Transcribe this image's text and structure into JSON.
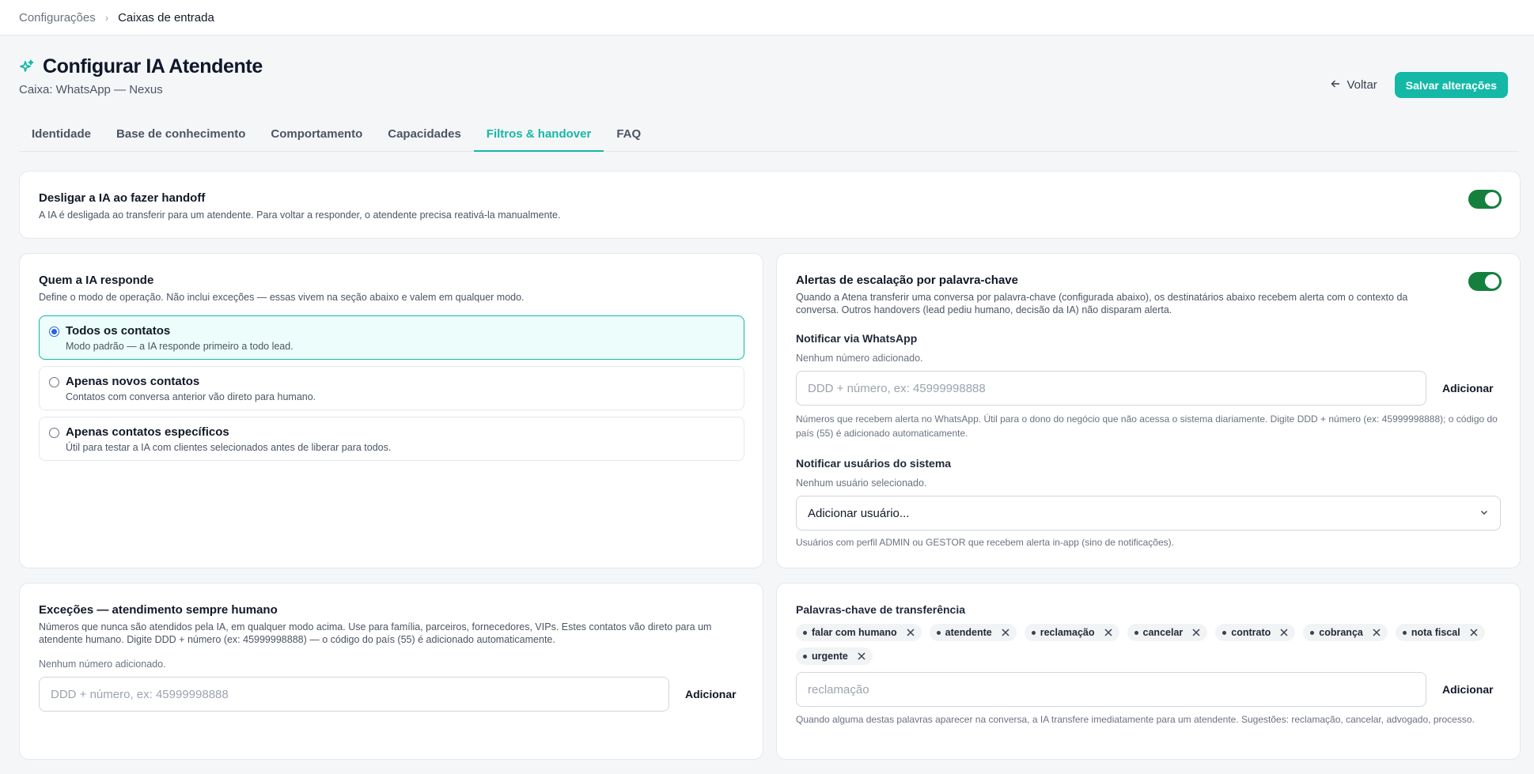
{
  "breadcrumb": {
    "root": "Configurações",
    "separator": "›",
    "current": "Caixas de entrada"
  },
  "header": {
    "title": "Configurar IA Atendente",
    "subtitle": "Caixa: WhatsApp — Nexus",
    "back_label": "Voltar",
    "save_label": "Salvar alterações"
  },
  "tabs": [
    {
      "label": "Identidade",
      "active": false
    },
    {
      "label": "Base de conhecimento",
      "active": false
    },
    {
      "label": "Comportamento",
      "active": false
    },
    {
      "label": "Capacidades",
      "active": false
    },
    {
      "label": "Filtros & handover",
      "active": true
    },
    {
      "label": "FAQ",
      "active": false
    }
  ],
  "handoff": {
    "title": "Desligar a IA ao fazer handoff",
    "desc": "A IA é desligada ao transferir para um atendente. Para voltar a responder, o atendente precisa reativá-la manualmente.",
    "enabled": true
  },
  "responds": {
    "title": "Quem a IA responde",
    "desc": "Define o modo de operação. Não inclui exceções — essas vivem na seção abaixo e valem em qualquer modo.",
    "options": [
      {
        "title": "Todos os contatos",
        "desc": "Modo padrão — a IA responde primeiro a todo lead.",
        "selected": true
      },
      {
        "title": "Apenas novos contatos",
        "desc": "Contatos com conversa anterior vão direto para humano.",
        "selected": false
      },
      {
        "title": "Apenas contatos específicos",
        "desc": "Útil para testar a IA com clientes selecionados antes de liberar para todos.",
        "selected": false
      }
    ]
  },
  "alerts": {
    "title": "Alertas de escalação por palavra-chave",
    "desc": "Quando a Atena transferir uma conversa por palavra-chave (configurada abaixo), os destinatários abaixo recebem alerta com o contexto da conversa. Outros handovers (lead pediu humano, decisão da IA) não disparam alerta.",
    "enabled": true,
    "whatsapp": {
      "label": "Notificar via WhatsApp",
      "empty": "Nenhum número adicionado.",
      "placeholder": "DDD + número, ex: 45999998888",
      "add_label": "Adicionar",
      "hint": "Números que recebem alerta no WhatsApp. Útil para o dono do negócio que não acessa o sistema diariamente. Digite DDD + número (ex: 45999998888); o código do país (55) é adicionado automaticamente."
    },
    "users": {
      "label": "Notificar usuários do sistema",
      "empty": "Nenhum usuário selecionado.",
      "select_value": "Adicionar usuário...",
      "hint": "Usuários com perfil ADMIN ou GESTOR que recebem alerta in-app (sino de notificações)."
    }
  },
  "exceptions": {
    "title": "Exceções — atendimento sempre humano",
    "desc": "Números que nunca são atendidos pela IA, em qualquer modo acima. Use para família, parceiros, fornecedores, VIPs. Estes contatos vão direto para um atendente humano. Digite DDD + número (ex: 45999998888) — o código do país (55) é adicionado automaticamente.",
    "empty": "Nenhum número adicionado.",
    "placeholder": "DDD + número, ex: 45999998888",
    "add_label": "Adicionar"
  },
  "keywords": {
    "title": "Palavras-chave de transferência",
    "chips": [
      "falar com humano",
      "atendente",
      "reclamação",
      "cancelar",
      "contrato",
      "cobrança",
      "nota fiscal",
      "urgente"
    ],
    "placeholder": "reclamação",
    "add_label": "Adicionar",
    "hint": "Quando alguma destas palavras aparecer na conversa, a IA transfere imediatamente para um atendente. Sugestões: reclamação, cancelar, advogado, processo."
  },
  "colors": {
    "accent": "#14b8a6",
    "toggle_on": "#15803d",
    "radio": "#2563eb"
  }
}
